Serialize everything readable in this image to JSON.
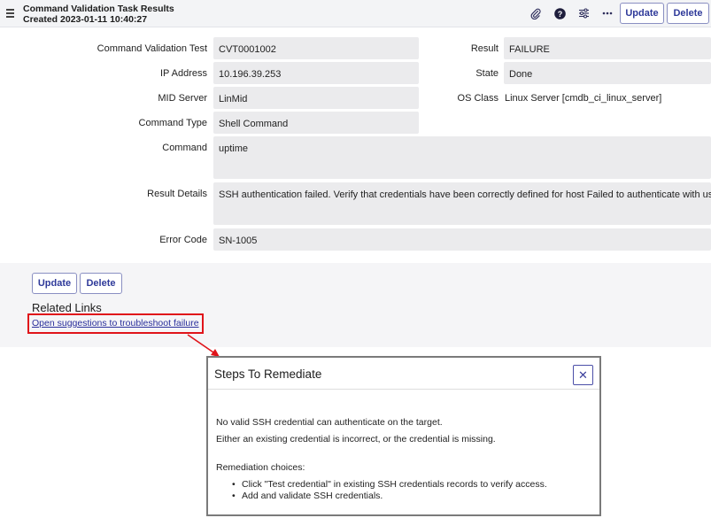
{
  "header": {
    "title": "Command Validation Task Results",
    "created": "Created 2023-01-11 10:40:27",
    "update_label": "Update",
    "delete_label": "Delete",
    "icons": [
      "menu-icon",
      "paperclip-icon",
      "help-icon",
      "settings-sliders-icon",
      "more-icon"
    ]
  },
  "form": {
    "command_validation_test": {
      "label": "Command Validation Test",
      "value": "CVT0001002"
    },
    "ip_address": {
      "label": "IP Address",
      "value": "10.196.39.253"
    },
    "mid_server": {
      "label": "MID Server",
      "value": "LinMid"
    },
    "command_type": {
      "label": "Command Type",
      "value": "Shell Command"
    },
    "command": {
      "label": "Command",
      "value": "uptime"
    },
    "result_details": {
      "label": "Result Details",
      "value": "SSH authentication failed. Verify that credentials have been correctly defined for host Failed to authenticate with user: ruty."
    },
    "error_code": {
      "label": "Error Code",
      "value": "SN-1005"
    },
    "result": {
      "label": "Result",
      "value": "FAILURE"
    },
    "state": {
      "label": "State",
      "value": "Done"
    },
    "os_class": {
      "label": "OS Class",
      "value": "Linux Server [cmdb_ci_linux_server]"
    }
  },
  "footer": {
    "update_label": "Update",
    "delete_label": "Delete",
    "related_links_heading": "Related Links",
    "link_text": "Open suggestions to troubleshoot failure"
  },
  "modal": {
    "title": "Steps To Remediate",
    "line1": "No valid SSH credential can authenticate on the target.",
    "line2": "Either an existing credential is incorrect, or the credential is missing.",
    "choices_heading": "Remediation choices:",
    "bullets": [
      "Click \"Test credential\" in existing SSH credentials records to verify access.",
      "Add and validate SSH credentials."
    ]
  },
  "colors": {
    "accent": "#2f3a9a",
    "highlight_border": "#e0141a",
    "field_bg": "#ebebed",
    "header_bg": "#f3f4f6"
  }
}
